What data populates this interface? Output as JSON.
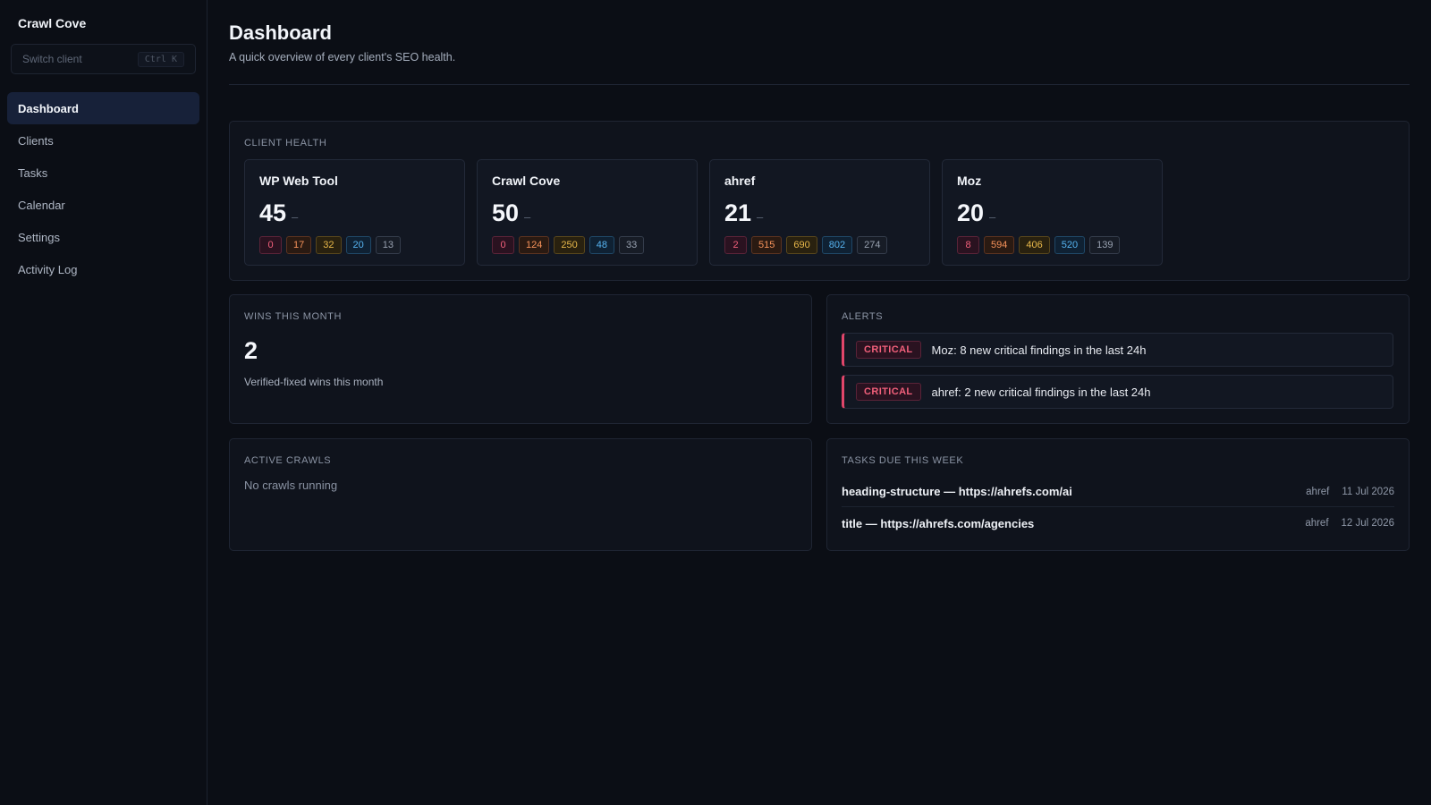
{
  "app": {
    "name": "Crawl Cove"
  },
  "sidebar": {
    "switcher": {
      "placeholder": "Switch client",
      "shortcut": "Ctrl K"
    },
    "items": [
      {
        "label": "Dashboard",
        "active": true
      },
      {
        "label": "Clients",
        "active": false
      },
      {
        "label": "Tasks",
        "active": false
      },
      {
        "label": "Calendar",
        "active": false
      },
      {
        "label": "Settings",
        "active": false
      },
      {
        "label": "Activity Log",
        "active": false
      }
    ]
  },
  "header": {
    "title": "Dashboard",
    "subtitle": "A quick overview of every client's SEO health."
  },
  "client_health": {
    "label": "CLIENT HEALTH",
    "clients": [
      {
        "name": "WP Web Tool",
        "score": "45",
        "trend": "–",
        "badges": [
          "0",
          "17",
          "32",
          "20",
          "13"
        ]
      },
      {
        "name": "Crawl Cove",
        "score": "50",
        "trend": "–",
        "badges": [
          "0",
          "124",
          "250",
          "48",
          "33"
        ]
      },
      {
        "name": "ahref",
        "score": "21",
        "trend": "–",
        "badges": [
          "2",
          "515",
          "690",
          "802",
          "274"
        ]
      },
      {
        "name": "Moz",
        "score": "20",
        "trend": "–",
        "badges": [
          "8",
          "594",
          "406",
          "520",
          "139"
        ]
      }
    ]
  },
  "wins": {
    "label": "WINS THIS MONTH",
    "value": "2",
    "description": "Verified-fixed wins this month"
  },
  "alerts": {
    "label": "ALERTS",
    "items": [
      {
        "severity": "CRITICAL",
        "text": "Moz: 8 new critical findings in the last 24h"
      },
      {
        "severity": "CRITICAL",
        "text": "ahref: 2 new critical findings in the last 24h"
      }
    ]
  },
  "active_crawls": {
    "label": "ACTIVE CRAWLS",
    "empty": "No crawls running"
  },
  "tasks": {
    "label": "TASKS DUE THIS WEEK",
    "items": [
      {
        "title": "heading-structure — https://ahrefs.com/ai",
        "client": "ahref",
        "date": "11 Jul 2026"
      },
      {
        "title": "title — https://ahrefs.com/agencies",
        "client": "ahref",
        "date": "12 Jul 2026"
      }
    ]
  },
  "colors": {
    "background": "#0b0e15",
    "panel": "#0f131c",
    "active_nav": "#172139",
    "critical": "#f2607b",
    "high": "#f5925a",
    "medium": "#e8b84a",
    "low": "#56b3f0",
    "info": "#98a1b0"
  }
}
